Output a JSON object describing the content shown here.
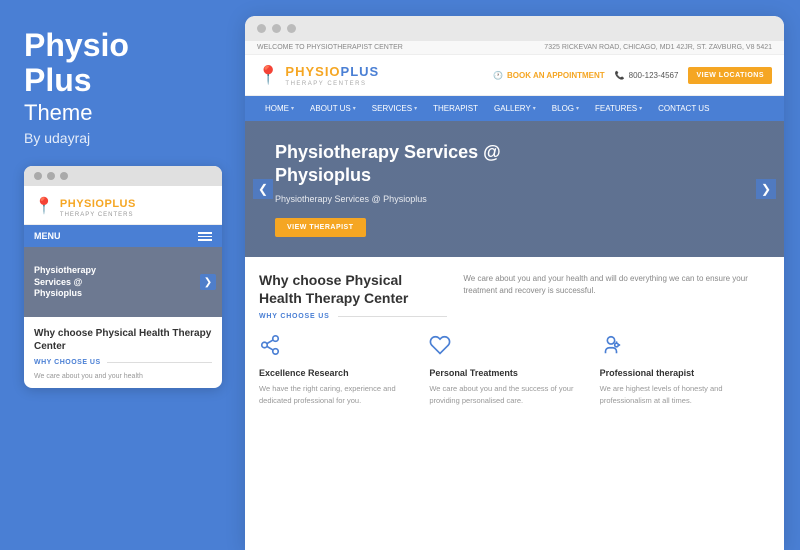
{
  "left": {
    "title_line1": "Physio",
    "title_line2": "Plus",
    "subtitle": "Theme",
    "by": "By udayraj",
    "mobile": {
      "dots": [
        "dot1",
        "dot2",
        "dot3"
      ],
      "logo_main": "PHYSIOPLUS",
      "logo_sub": "THERAPY CENTERS",
      "menu_label": "MENU",
      "hero_text_line1": "Physiotherapy",
      "hero_text_line2": "Services @",
      "hero_text_line3": "Physioplus",
      "hero_arrow": "❯",
      "section_title": "Why choose Physical Health Therapy Center",
      "why_label": "WHY CHOOSE US",
      "body_text": "We care about you and your health"
    }
  },
  "right": {
    "browser_dots": [
      "d1",
      "d2",
      "d3"
    ],
    "top_info_left": "WELCOME TO PHYSIOTHERAPIST CENTER",
    "top_info_right": "7325 RICKEVAN ROAD, CHICAGO, MD1 42JR, ST. ZAVBURG, V8 5421",
    "logo_main": "PHYSIOPLUS",
    "logo_pre": "PHYSIO",
    "logo_blue": "PLUS",
    "logo_sub": "THERAPY CENTERS",
    "header": {
      "appointment_label": "BOOK AN APPOINTMENT",
      "phone": "800-123-4567",
      "locations_btn": "VIEW LOCATIONS"
    },
    "nav": {
      "items": [
        {
          "label": "HOME",
          "has_arrow": true
        },
        {
          "label": "ABOUT US",
          "has_arrow": true
        },
        {
          "label": "SERVICES",
          "has_arrow": true
        },
        {
          "label": "THERAPIST",
          "has_arrow": false
        },
        {
          "label": "GALLERY",
          "has_arrow": true
        },
        {
          "label": "BLOG",
          "has_arrow": true
        },
        {
          "label": "FEATURES",
          "has_arrow": true
        },
        {
          "label": "CONTACT US",
          "has_arrow": false
        }
      ]
    },
    "hero": {
      "title": "Physiotherapy Services @ Physioplus",
      "subtitle": "Physiotherapy Services @ Physioplus",
      "btn_label": "VIEW THERAPIST",
      "arrow_left": "❮",
      "arrow_right": "❯"
    },
    "why": {
      "title": "Why choose Physical Health Therapy Center",
      "label": "WHY CHOOSE US",
      "right_text": "We care about you and your health and will do everything we can to ensure your treatment and recovery is successful."
    },
    "features": [
      {
        "icon": "share",
        "title": "Excellence Research",
        "desc": "We have the right caring, experience and dedicated professional for you."
      },
      {
        "icon": "heart",
        "title": "Personal Treatments",
        "desc": "We care about you and the success of your providing personalised care."
      },
      {
        "icon": "person",
        "title": "Professional therapist",
        "desc": "We are highest levels of honesty and professionalism at all times."
      }
    ]
  }
}
